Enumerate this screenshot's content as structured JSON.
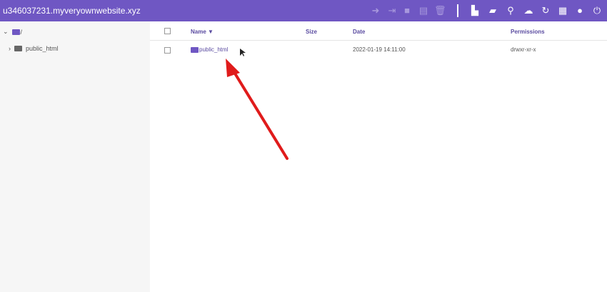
{
  "header": {
    "title": "u346037231.myveryownwebsite.xyz",
    "toolbar": [
      "arrow-right-icon",
      "exit-icon",
      "lock-icon",
      "archive-icon",
      "trash-icon",
      "new-file-icon",
      "new-folder-icon",
      "search-icon",
      "upload-icon",
      "refresh-icon",
      "grid-icon",
      "globe-icon",
      "power-icon"
    ]
  },
  "sidebar": {
    "root": "/",
    "items": [
      {
        "label": "public_html"
      }
    ]
  },
  "table": {
    "columns": {
      "name": "Name ▼",
      "size": "Size",
      "date": "Date",
      "permissions": "Permissions"
    },
    "rows": [
      {
        "name": "public_html",
        "size": "",
        "date": "2022-01-19 14:11:00",
        "permissions": "drwxr-xr-x"
      }
    ]
  },
  "colors": {
    "accent": "#6f57c3",
    "folder": "#6f57c3",
    "arrow": "#e01b1b"
  }
}
